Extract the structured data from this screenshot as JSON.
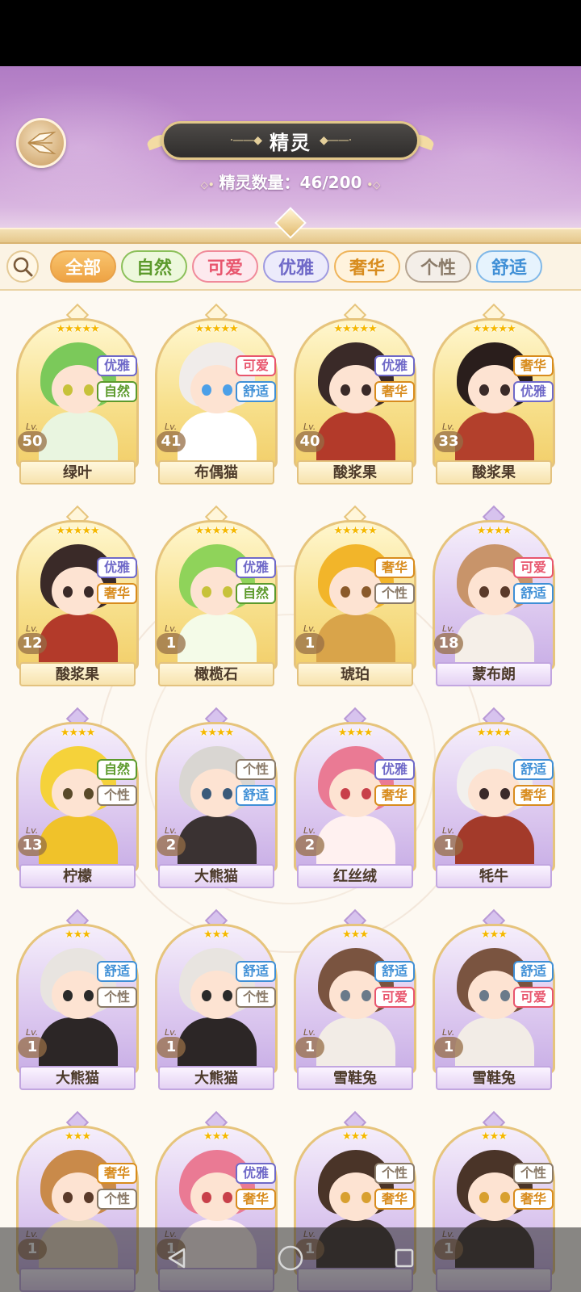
{
  "header": {
    "title": "精灵",
    "count_label": "精灵数量：46/200"
  },
  "filters": [
    {
      "label": "全部",
      "color": "#e8a24a",
      "text": "#ffffff",
      "bg": "#f5b85c",
      "active": true
    },
    {
      "label": "自然",
      "color": "#8cc05a",
      "text": "#5c9a2c",
      "bg": "#edf8dc"
    },
    {
      "label": "可爱",
      "color": "#f08a9a",
      "text": "#e8566e",
      "bg": "#fde9ee"
    },
    {
      "label": "优雅",
      "color": "#9f9ae0",
      "text": "#6f69c8",
      "bg": "#ecebfb"
    },
    {
      "label": "奢华",
      "color": "#efb45a",
      "text": "#d88c1e",
      "bg": "#fff3dd"
    },
    {
      "label": "个性",
      "color": "#b6a592",
      "text": "#8a7a68",
      "bg": "#f3eee8"
    },
    {
      "label": "舒适",
      "color": "#80b8e8",
      "text": "#3f8fd6",
      "bg": "#e6f3fd"
    }
  ],
  "tag_colors": {
    "优雅": "#6f69c8",
    "自然": "#5c9a2c",
    "可爱": "#e8566e",
    "舒适": "#3f8fd6",
    "奢华": "#d88c1e",
    "个性": "#8a7a68"
  },
  "lv_label": "Lv.",
  "cards": [
    {
      "name": "绿叶",
      "level": "50",
      "stars": "★★★★★",
      "tags": [
        "优雅",
        "自然"
      ],
      "frame": "gold",
      "hair": "#7bc95a",
      "body": "#e9f5e0",
      "eye": "#c7c23a"
    },
    {
      "name": "布偶猫",
      "level": "41",
      "stars": "★★★★★",
      "tags": [
        "可爱",
        "舒适"
      ],
      "frame": "gold",
      "hair": "#f0ecea",
      "body": "#ffffff",
      "eye": "#4ca0e8"
    },
    {
      "name": "酸浆果",
      "level": "40",
      "stars": "★★★★★",
      "tags": [
        "优雅",
        "奢华"
      ],
      "frame": "gold",
      "hair": "#3a2a28",
      "body": "#b33a2a",
      "eye": "#3a2a28"
    },
    {
      "name": "酸浆果",
      "level": "33",
      "stars": "★★★★★",
      "tags": [
        "奢华",
        "优雅"
      ],
      "frame": "gold",
      "hair": "#2a1e1c",
      "body": "#b3402c",
      "eye": "#3a2a28"
    },
    {
      "name": "酸浆果",
      "level": "12",
      "stars": "★★★★★",
      "tags": [
        "优雅",
        "奢华"
      ],
      "frame": "gold",
      "hair": "#3a2a28",
      "body": "#b33a2a",
      "eye": "#3a2a28"
    },
    {
      "name": "橄榄石",
      "level": "1",
      "stars": "★★★★★",
      "tags": [
        "优雅",
        "自然"
      ],
      "frame": "gold",
      "hair": "#8fd35a",
      "body": "#f4fbe8",
      "eye": "#c7c23a"
    },
    {
      "name": "琥珀",
      "level": "1",
      "stars": "★★★★★",
      "tags": [
        "奢华",
        "个性"
      ],
      "frame": "gold",
      "hair": "#f2b52a",
      "body": "#d9a44a",
      "eye": "#8a5a2a"
    },
    {
      "name": "蒙布朗",
      "level": "18",
      "stars": "★★★★",
      "tags": [
        "可爱",
        "舒适"
      ],
      "frame": "purple",
      "hair": "#c8946a",
      "body": "#f5efe8",
      "eye": "#5a3a2a"
    },
    {
      "name": "柠檬",
      "level": "13",
      "stars": "★★★★",
      "tags": [
        "自然",
        "个性"
      ],
      "frame": "purple",
      "hair": "#f5d23a",
      "body": "#f0c22a",
      "eye": "#5a4a2a"
    },
    {
      "name": "大熊猫",
      "level": "2",
      "stars": "★★★★",
      "tags": [
        "个性",
        "舒适"
      ],
      "frame": "purple",
      "hair": "#d9d6d2",
      "body": "#3a3232",
      "eye": "#3a5a7a"
    },
    {
      "name": "红丝绒",
      "level": "2",
      "stars": "★★★★",
      "tags": [
        "优雅",
        "奢华"
      ],
      "frame": "purple",
      "hair": "#ea7a94",
      "body": "#fff1f0",
      "eye": "#c8404a"
    },
    {
      "name": "牦牛",
      "level": "1",
      "stars": "★★★★",
      "tags": [
        "舒适",
        "奢华"
      ],
      "frame": "purple",
      "hair": "#f2f0ec",
      "body": "#a33a2a",
      "eye": "#3a2a2a"
    },
    {
      "name": "大熊猫",
      "level": "1",
      "stars": "★★★",
      "tags": [
        "舒适",
        "个性"
      ],
      "frame": "purple",
      "hair": "#e8e4e0",
      "body": "#2c2626",
      "eye": "#2a2a2a"
    },
    {
      "name": "大熊猫",
      "level": "1",
      "stars": "★★★",
      "tags": [
        "舒适",
        "个性"
      ],
      "frame": "purple",
      "hair": "#e8e4e0",
      "body": "#2c2626",
      "eye": "#2a2a2a"
    },
    {
      "name": "雪鞋兔",
      "level": "1",
      "stars": "★★★",
      "tags": [
        "舒适",
        "可爱"
      ],
      "frame": "purple",
      "hair": "#7a5440",
      "body": "#f2ece6",
      "eye": "#6a7a8a"
    },
    {
      "name": "雪鞋兔",
      "level": "1",
      "stars": "★★★",
      "tags": [
        "舒适",
        "可爱"
      ],
      "frame": "purple",
      "hair": "#7a5440",
      "body": "#f2ece6",
      "eye": "#6a7a8a"
    },
    {
      "name": "",
      "level": "1",
      "stars": "★★★",
      "tags": [
        "奢华",
        "个性"
      ],
      "frame": "purple",
      "hair": "#c98a4a",
      "body": "#e8d8c0",
      "eye": "#5a3a2a"
    },
    {
      "name": "",
      "level": "1",
      "stars": "★★★",
      "tags": [
        "优雅",
        "奢华"
      ],
      "frame": "purple",
      "hair": "#ea7a94",
      "body": "#fff1f0",
      "eye": "#c8404a"
    },
    {
      "name": "",
      "level": "1",
      "stars": "★★★",
      "tags": [
        "个性",
        "奢华"
      ],
      "frame": "purple",
      "hair": "#4a3428",
      "body": "#3a302a",
      "eye": "#d8a030"
    },
    {
      "name": "",
      "level": "1",
      "stars": "★★★",
      "tags": [
        "个性",
        "奢华"
      ],
      "frame": "purple",
      "hair": "#4a3428",
      "body": "#3a302a",
      "eye": "#d8a030"
    }
  ]
}
